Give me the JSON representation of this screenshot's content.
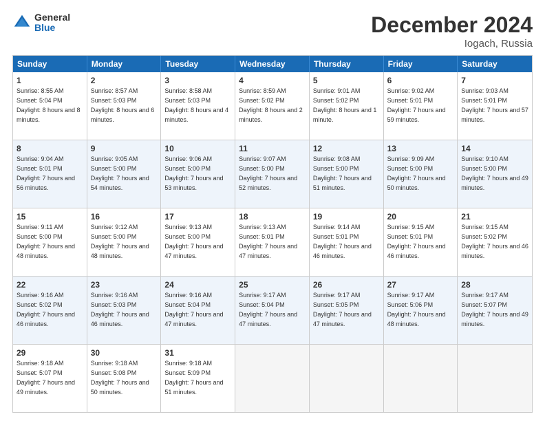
{
  "logo": {
    "text_general": "General",
    "text_blue": "Blue"
  },
  "title": "December 2024",
  "subtitle": "Iogach, Russia",
  "days_of_week": [
    "Sunday",
    "Monday",
    "Tuesday",
    "Wednesday",
    "Thursday",
    "Friday",
    "Saturday"
  ],
  "weeks": [
    [
      {
        "day": 1,
        "sunrise": "Sunrise: 8:55 AM",
        "sunset": "Sunset: 5:04 PM",
        "daylight": "Daylight: 8 hours and 8 minutes."
      },
      {
        "day": 2,
        "sunrise": "Sunrise: 8:57 AM",
        "sunset": "Sunset: 5:03 PM",
        "daylight": "Daylight: 8 hours and 6 minutes."
      },
      {
        "day": 3,
        "sunrise": "Sunrise: 8:58 AM",
        "sunset": "Sunset: 5:03 PM",
        "daylight": "Daylight: 8 hours and 4 minutes."
      },
      {
        "day": 4,
        "sunrise": "Sunrise: 8:59 AM",
        "sunset": "Sunset: 5:02 PM",
        "daylight": "Daylight: 8 hours and 2 minutes."
      },
      {
        "day": 5,
        "sunrise": "Sunrise: 9:01 AM",
        "sunset": "Sunset: 5:02 PM",
        "daylight": "Daylight: 8 hours and 1 minute."
      },
      {
        "day": 6,
        "sunrise": "Sunrise: 9:02 AM",
        "sunset": "Sunset: 5:01 PM",
        "daylight": "Daylight: 7 hours and 59 minutes."
      },
      {
        "day": 7,
        "sunrise": "Sunrise: 9:03 AM",
        "sunset": "Sunset: 5:01 PM",
        "daylight": "Daylight: 7 hours and 57 minutes."
      }
    ],
    [
      {
        "day": 8,
        "sunrise": "Sunrise: 9:04 AM",
        "sunset": "Sunset: 5:01 PM",
        "daylight": "Daylight: 7 hours and 56 minutes."
      },
      {
        "day": 9,
        "sunrise": "Sunrise: 9:05 AM",
        "sunset": "Sunset: 5:00 PM",
        "daylight": "Daylight: 7 hours and 54 minutes."
      },
      {
        "day": 10,
        "sunrise": "Sunrise: 9:06 AM",
        "sunset": "Sunset: 5:00 PM",
        "daylight": "Daylight: 7 hours and 53 minutes."
      },
      {
        "day": 11,
        "sunrise": "Sunrise: 9:07 AM",
        "sunset": "Sunset: 5:00 PM",
        "daylight": "Daylight: 7 hours and 52 minutes."
      },
      {
        "day": 12,
        "sunrise": "Sunrise: 9:08 AM",
        "sunset": "Sunset: 5:00 PM",
        "daylight": "Daylight: 7 hours and 51 minutes."
      },
      {
        "day": 13,
        "sunrise": "Sunrise: 9:09 AM",
        "sunset": "Sunset: 5:00 PM",
        "daylight": "Daylight: 7 hours and 50 minutes."
      },
      {
        "day": 14,
        "sunrise": "Sunrise: 9:10 AM",
        "sunset": "Sunset: 5:00 PM",
        "daylight": "Daylight: 7 hours and 49 minutes."
      }
    ],
    [
      {
        "day": 15,
        "sunrise": "Sunrise: 9:11 AM",
        "sunset": "Sunset: 5:00 PM",
        "daylight": "Daylight: 7 hours and 48 minutes."
      },
      {
        "day": 16,
        "sunrise": "Sunrise: 9:12 AM",
        "sunset": "Sunset: 5:00 PM",
        "daylight": "Daylight: 7 hours and 48 minutes."
      },
      {
        "day": 17,
        "sunrise": "Sunrise: 9:13 AM",
        "sunset": "Sunset: 5:00 PM",
        "daylight": "Daylight: 7 hours and 47 minutes."
      },
      {
        "day": 18,
        "sunrise": "Sunrise: 9:13 AM",
        "sunset": "Sunset: 5:01 PM",
        "daylight": "Daylight: 7 hours and 47 minutes."
      },
      {
        "day": 19,
        "sunrise": "Sunrise: 9:14 AM",
        "sunset": "Sunset: 5:01 PM",
        "daylight": "Daylight: 7 hours and 46 minutes."
      },
      {
        "day": 20,
        "sunrise": "Sunrise: 9:15 AM",
        "sunset": "Sunset: 5:01 PM",
        "daylight": "Daylight: 7 hours and 46 minutes."
      },
      {
        "day": 21,
        "sunrise": "Sunrise: 9:15 AM",
        "sunset": "Sunset: 5:02 PM",
        "daylight": "Daylight: 7 hours and 46 minutes."
      }
    ],
    [
      {
        "day": 22,
        "sunrise": "Sunrise: 9:16 AM",
        "sunset": "Sunset: 5:02 PM",
        "daylight": "Daylight: 7 hours and 46 minutes."
      },
      {
        "day": 23,
        "sunrise": "Sunrise: 9:16 AM",
        "sunset": "Sunset: 5:03 PM",
        "daylight": "Daylight: 7 hours and 46 minutes."
      },
      {
        "day": 24,
        "sunrise": "Sunrise: 9:16 AM",
        "sunset": "Sunset: 5:04 PM",
        "daylight": "Daylight: 7 hours and 47 minutes."
      },
      {
        "day": 25,
        "sunrise": "Sunrise: 9:17 AM",
        "sunset": "Sunset: 5:04 PM",
        "daylight": "Daylight: 7 hours and 47 minutes."
      },
      {
        "day": 26,
        "sunrise": "Sunrise: 9:17 AM",
        "sunset": "Sunset: 5:05 PM",
        "daylight": "Daylight: 7 hours and 47 minutes."
      },
      {
        "day": 27,
        "sunrise": "Sunrise: 9:17 AM",
        "sunset": "Sunset: 5:06 PM",
        "daylight": "Daylight: 7 hours and 48 minutes."
      },
      {
        "day": 28,
        "sunrise": "Sunrise: 9:17 AM",
        "sunset": "Sunset: 5:07 PM",
        "daylight": "Daylight: 7 hours and 49 minutes."
      }
    ],
    [
      {
        "day": 29,
        "sunrise": "Sunrise: 9:18 AM",
        "sunset": "Sunset: 5:07 PM",
        "daylight": "Daylight: 7 hours and 49 minutes."
      },
      {
        "day": 30,
        "sunrise": "Sunrise: 9:18 AM",
        "sunset": "Sunset: 5:08 PM",
        "daylight": "Daylight: 7 hours and 50 minutes."
      },
      {
        "day": 31,
        "sunrise": "Sunrise: 9:18 AM",
        "sunset": "Sunset: 5:09 PM",
        "daylight": "Daylight: 7 hours and 51 minutes."
      },
      null,
      null,
      null,
      null
    ]
  ]
}
